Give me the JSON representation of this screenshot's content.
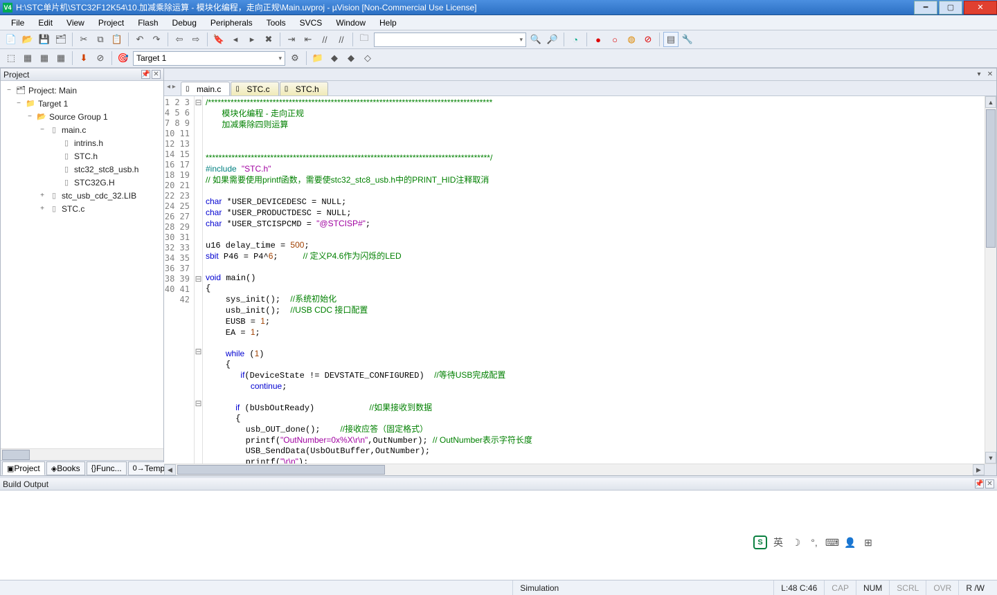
{
  "title": "H:\\STC单片机\\STC32F12K54\\10.加减乘除运算 - 模块化编程，走向正规\\Main.uvproj - µVision  [Non-Commercial Use License]",
  "menu": {
    "items": [
      "File",
      "Edit",
      "View",
      "Project",
      "Flash",
      "Debug",
      "Peripherals",
      "Tools",
      "SVCS",
      "Window",
      "Help"
    ]
  },
  "target_selector": "Target 1",
  "project_pane": {
    "title": "Project",
    "root": "Project: Main",
    "target": "Target 1",
    "group": "Source Group 1",
    "files_main": [
      "main.c",
      "intrins.h",
      "STC.h",
      "stc32_stc8_usb.h",
      "STC32G.H"
    ],
    "files_other": [
      "stc_usb_cdc_32.LIB",
      "STC.c"
    ],
    "tabs": [
      "Project",
      "Books",
      "Func...",
      "Temp..."
    ]
  },
  "editor": {
    "tabs": [
      {
        "label": "main.c",
        "active": true
      },
      {
        "label": "STC.c",
        "active": false
      },
      {
        "label": "STC.h",
        "active": false
      }
    ],
    "lines_visible": 42
  },
  "build_output": {
    "title": "Build Output",
    "ime_label": "英"
  },
  "status": {
    "mode": "Simulation",
    "pos": "L:48 C:46",
    "caps": "CAP",
    "num": "NUM",
    "scrl": "SCRL",
    "ovr": "OVR",
    "rw": "R /W"
  }
}
